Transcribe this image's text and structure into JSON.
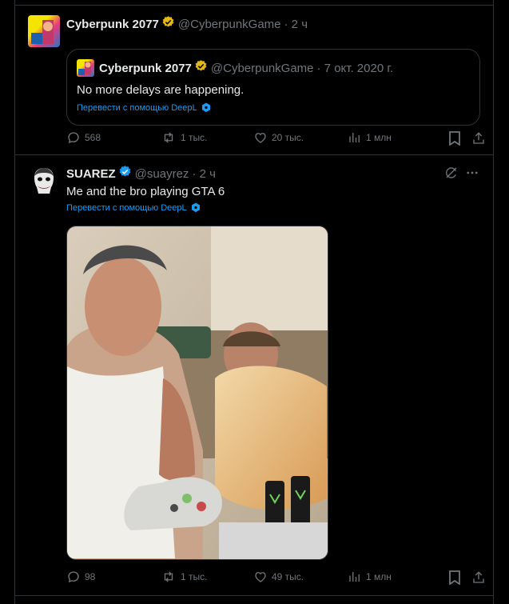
{
  "colors": {
    "accent": "#1d9bf0",
    "muted": "#71767b",
    "text": "#e7e9ea",
    "border": "#2f3336",
    "gold_badge": "#e2b719",
    "blue_badge": "#1d9bf0"
  },
  "tweet1": {
    "name": "Cyberpunk 2077",
    "handle": "@CyberpunkGame",
    "time": "· 2 ч",
    "quote": {
      "name": "Cyberpunk 2077",
      "handle": "@CyberpunkGame",
      "date": "· 7 окт. 2020 г.",
      "text": "No more delays are happening.",
      "translate": "Перевести с помощью DeepL"
    },
    "stats": {
      "replies": "568",
      "reposts": "1 тыс.",
      "likes": "20 тыс.",
      "views": "1 млн"
    }
  },
  "tweet2": {
    "name": "SUAREZ",
    "handle": "@suayrez",
    "time": "· 2 ч",
    "text": "Me and the bro playing GTA 6",
    "translate": "Перевести с помощью DeepL",
    "stats": {
      "replies": "98",
      "reposts": "1 тыс.",
      "likes": "49 тыс.",
      "views": "1 млн"
    }
  },
  "icons": [
    "gold-verified-badge-icon",
    "blue-verified-badge-icon",
    "reply-icon",
    "repost-icon",
    "like-icon",
    "views-icon",
    "bookmark-icon",
    "share-icon",
    "grok-icon",
    "more-icon",
    "deepl-icon"
  ]
}
